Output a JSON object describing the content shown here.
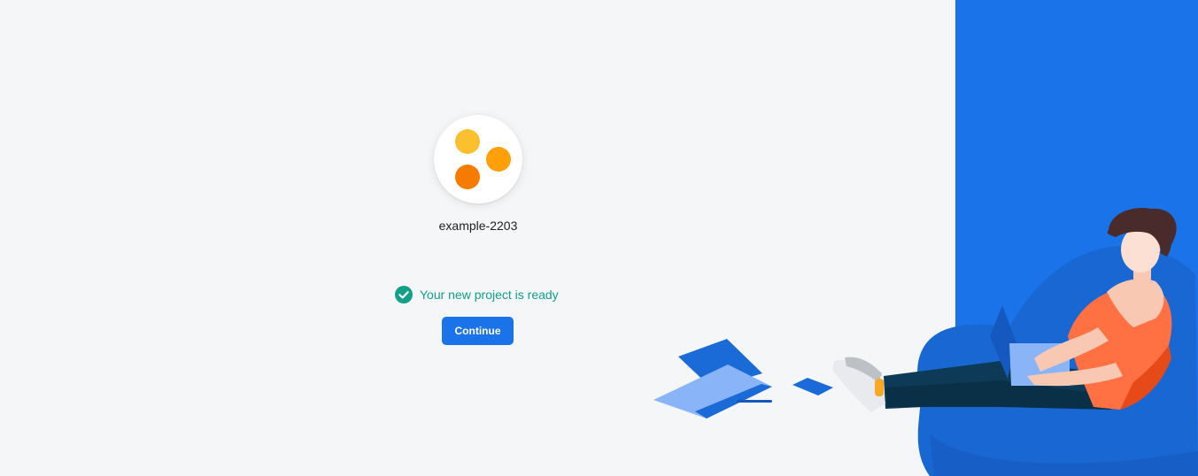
{
  "project": {
    "name": "example-2203",
    "avatar_colors": [
      "#fbc02d",
      "#ff9800",
      "#f57c00"
    ]
  },
  "status": {
    "message": "Your new project is ready",
    "icon": "check-circle-icon",
    "color": "#12a088"
  },
  "actions": {
    "continue_label": "Continue"
  },
  "theme": {
    "background": "#f4f6f8",
    "accent": "#1a73e8"
  }
}
